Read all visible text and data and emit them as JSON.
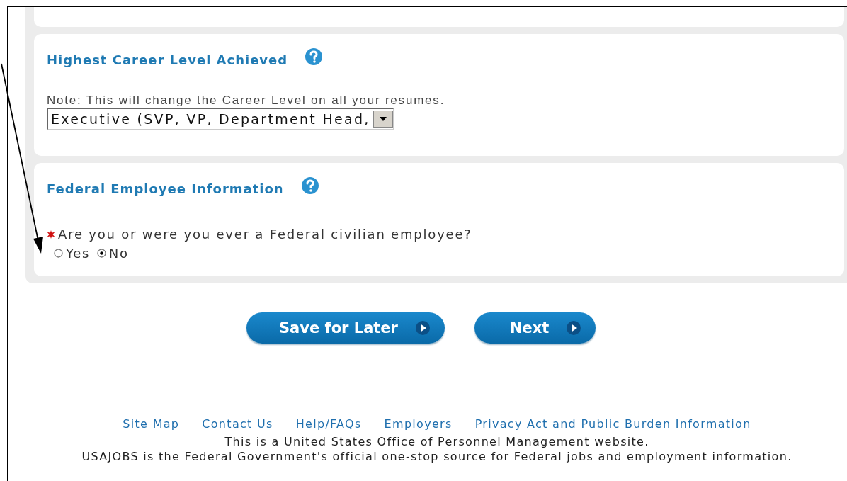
{
  "sections": [
    {
      "kind": "blank"
    },
    {
      "kind": "select",
      "title": "Highest Career Level Achieved",
      "help": true,
      "note": "Note: This will change the Career Level on all your resumes.",
      "value": "Executive (SVP, VP, Department Head,"
    },
    {
      "kind": "radio",
      "title": "Federal Employee Information",
      "help": true,
      "required": true,
      "question": "Are you or were you ever a Federal civilian employee?",
      "options": [
        {
          "label": "Yes",
          "selected": false
        },
        {
          "label": "No",
          "selected": true
        }
      ]
    }
  ],
  "buttons": [
    "Save for Later",
    "Next"
  ],
  "footer": {
    "links": [
      "Site Map",
      "Contact Us",
      "Help/FAQs",
      "Employers",
      "Privacy Act and Public Burden Information"
    ],
    "lines": [
      "This is a United States Office of Personnel Management website.",
      "USAJOBS is the Federal Government's official one-stop source for Federal jobs and employment information."
    ]
  }
}
